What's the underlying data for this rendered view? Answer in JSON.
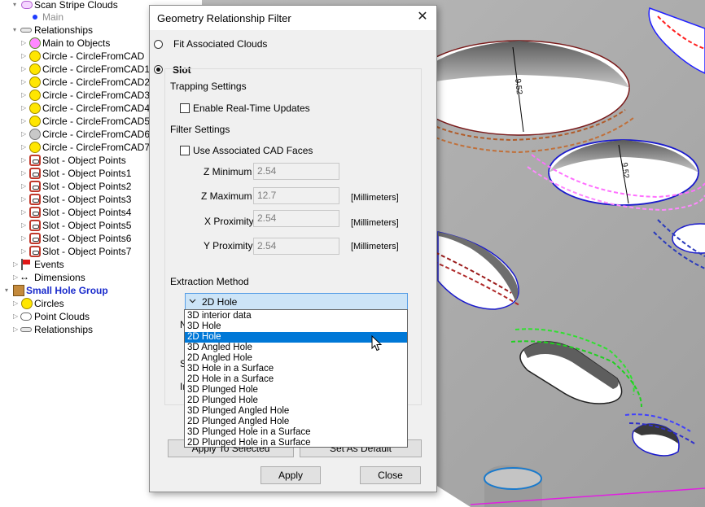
{
  "tree": {
    "top_item": {
      "label": "Scan Stripe Clouds",
      "icon": "cloud-icon"
    },
    "main_item": {
      "label": "Main",
      "icon": "dot-icon"
    },
    "relationships": {
      "label": "Relationships",
      "icon": "relationship-icon"
    },
    "main_to_objects": {
      "label": "Main to Objects",
      "icon": "object-icon"
    },
    "circles": [
      {
        "label": "Circle - CircleFromCAD"
      },
      {
        "label": "Circle - CircleFromCAD1"
      },
      {
        "label": "Circle - CircleFromCAD2"
      },
      {
        "label": "Circle - CircleFromCAD3"
      },
      {
        "label": "Circle - CircleFromCAD4"
      },
      {
        "label": "Circle - CircleFromCAD5"
      },
      {
        "label": "Circle - CircleFromCAD6"
      },
      {
        "label": "Circle - CircleFromCAD7"
      }
    ],
    "slots": [
      {
        "label": "Slot - Object Points"
      },
      {
        "label": "Slot - Object Points1"
      },
      {
        "label": "Slot - Object Points2"
      },
      {
        "label": "Slot - Object Points3"
      },
      {
        "label": "Slot - Object Points4"
      },
      {
        "label": "Slot - Object Points5"
      },
      {
        "label": "Slot - Object Points6"
      },
      {
        "label": "Slot - Object Points7"
      }
    ],
    "events": {
      "label": "Events",
      "icon": "flag-icon"
    },
    "dimensions": {
      "label": "Dimensions",
      "icon": "dimensions-icon"
    },
    "group": {
      "label": "Small Hole Group",
      "icon": "box-icon"
    },
    "group_circles": {
      "label": "Circles"
    },
    "group_clouds": {
      "label": "Point Clouds"
    },
    "group_relationships": {
      "label": "Relationships"
    }
  },
  "dialog": {
    "title": "Geometry Relationship Filter",
    "fit_clouds": "Fit Associated Clouds",
    "slot": "Slot",
    "trapping_settings": "Trapping Settings",
    "realtime": "Enable Real-Time Updates",
    "filter_settings": "Filter Settings",
    "use_cad": "Use Associated CAD Faces",
    "z_min": {
      "label": "Z Minimum",
      "value": "2.54"
    },
    "z_max": {
      "label": "Z Maximum",
      "value": "12.7",
      "unit": "[Millimeters]"
    },
    "x_prox": {
      "label": "X Proximity",
      "value": "2.54",
      "unit": "[Millimeters]"
    },
    "y_prox": {
      "label": "Y Proximity",
      "value": "2.54",
      "unit": "[Millimeters]"
    },
    "extraction_method": "Extraction Method",
    "selected_method": "2D Hole",
    "options": [
      "3D interior data",
      "3D Hole",
      "2D Hole",
      "3D Angled Hole",
      "2D Angled Hole",
      "3D Hole in a Surface",
      "2D Hole in a Surface",
      "3D Plunged Hole",
      "2D Plunged Hole",
      "3D Plunged Angled Hole",
      "2D Plunged Angled Hole",
      "3D Plunged Hole in a Surface",
      "2D Plunged Hole in a Surface"
    ],
    "selected_index": 2,
    "partial_labels": [
      "N",
      "S",
      "In"
    ],
    "apply_to_selected": "Apply To Selected",
    "set_as_default": "Set As Default",
    "apply": "Apply",
    "close": "Close"
  },
  "viewport": {
    "dim_labels": [
      "9.52",
      "9.52"
    ]
  },
  "colors": {
    "accent": "#0078d7",
    "combo_bg": "#cce4f7",
    "group_label": "#1a2bcc"
  }
}
